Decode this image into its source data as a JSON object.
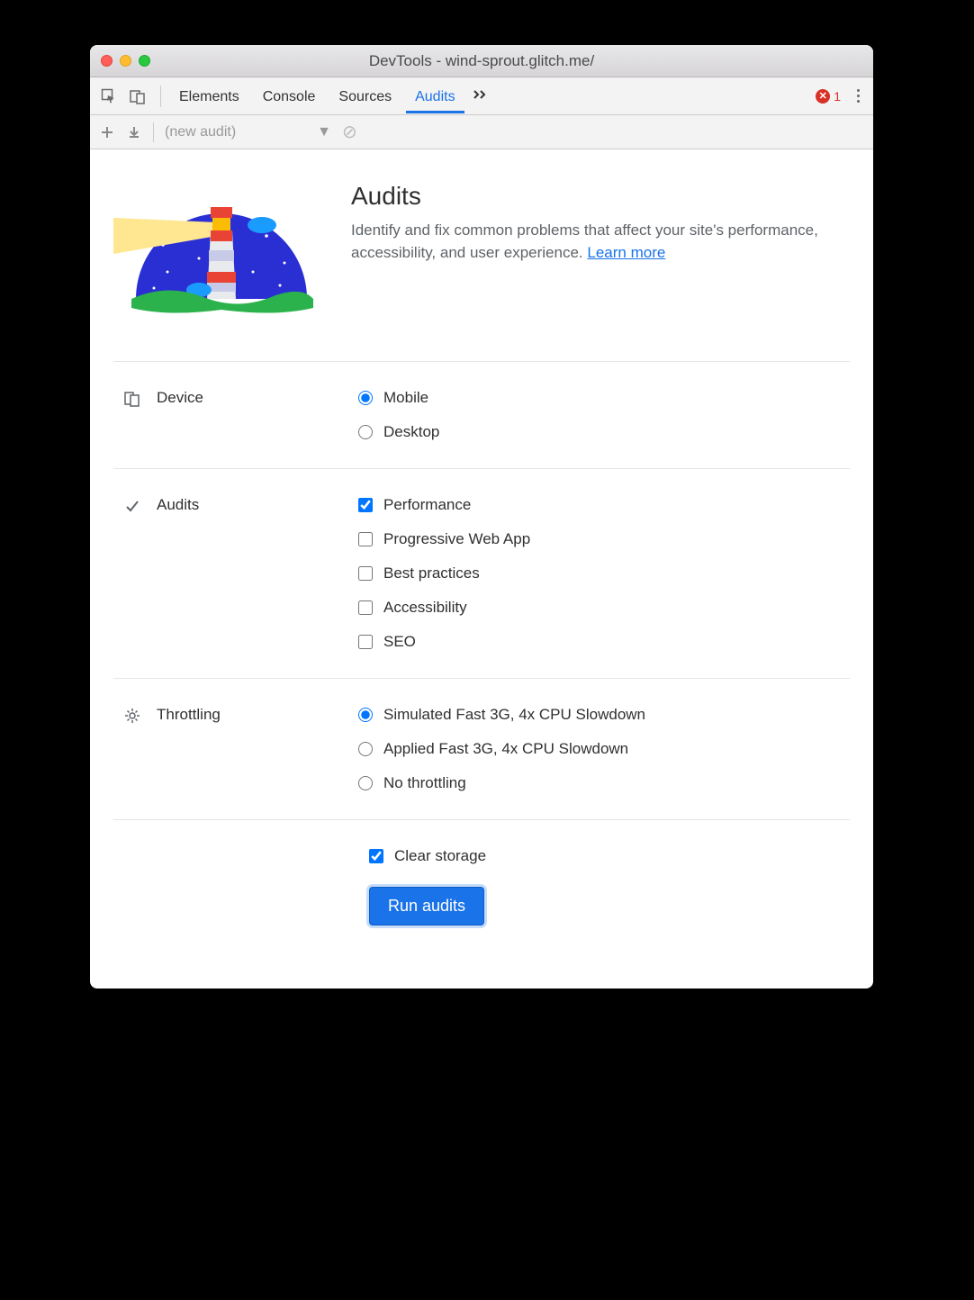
{
  "window": {
    "title": "DevTools - wind-sprout.glitch.me/"
  },
  "tabs": {
    "items": [
      "Elements",
      "Console",
      "Sources",
      "Audits"
    ],
    "active": "Audits",
    "errorCount": "1"
  },
  "subbar": {
    "selection": "(new audit)"
  },
  "intro": {
    "heading": "Audits",
    "body": "Identify and fix common problems that affect your site's performance, accessibility, and user experience. ",
    "learn": "Learn more"
  },
  "sections": {
    "device": {
      "label": "Device",
      "options": [
        {
          "label": "Mobile",
          "checked": true
        },
        {
          "label": "Desktop",
          "checked": false
        }
      ]
    },
    "audits": {
      "label": "Audits",
      "options": [
        {
          "label": "Performance",
          "checked": true
        },
        {
          "label": "Progressive Web App",
          "checked": false
        },
        {
          "label": "Best practices",
          "checked": false
        },
        {
          "label": "Accessibility",
          "checked": false
        },
        {
          "label": "SEO",
          "checked": false
        }
      ]
    },
    "throttling": {
      "label": "Throttling",
      "options": [
        {
          "label": "Simulated Fast 3G, 4x CPU Slowdown",
          "checked": true
        },
        {
          "label": "Applied Fast 3G, 4x CPU Slowdown",
          "checked": false
        },
        {
          "label": "No throttling",
          "checked": false
        }
      ]
    }
  },
  "clearStorage": {
    "label": "Clear storage",
    "checked": true
  },
  "runButton": "Run audits"
}
